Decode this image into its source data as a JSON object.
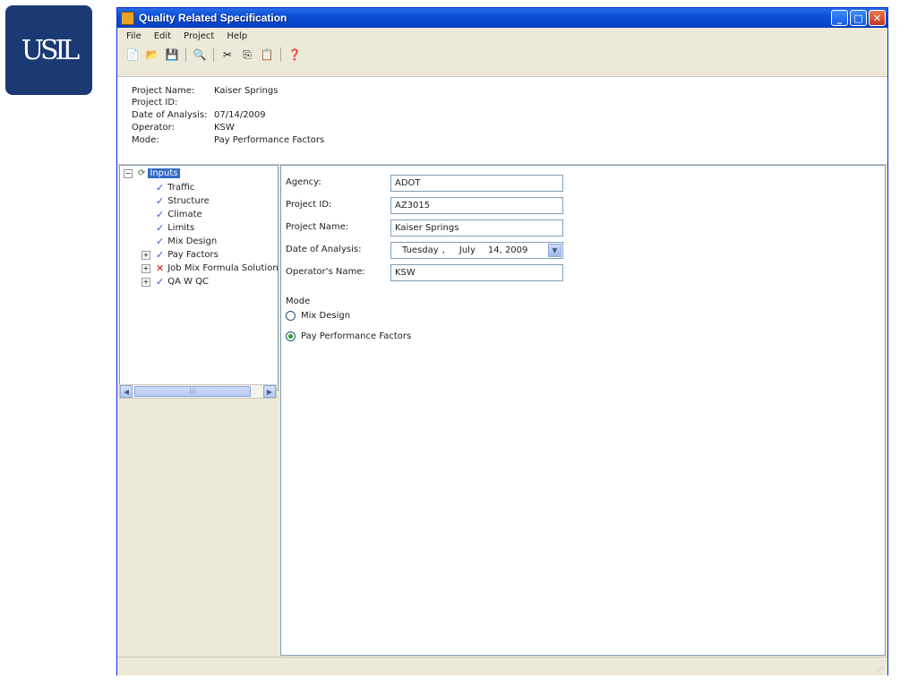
{
  "logo": {
    "text": "USIL"
  },
  "window": {
    "title": "Quality Related Specification",
    "controls": {
      "minimize": "_",
      "maximize": "□",
      "close": "✕"
    }
  },
  "menu": {
    "items": [
      "File",
      "Edit",
      "Project",
      "Help"
    ]
  },
  "toolbar": {
    "icons": [
      "new-icon",
      "open-icon",
      "save-icon",
      "print-preview-icon",
      "cut-icon",
      "copy-icon",
      "paste-icon",
      "help-icon"
    ]
  },
  "info": {
    "project_name_label": "Project Name:",
    "project_name": "Kaiser Springs",
    "project_id_label": "Project ID:",
    "project_id": "",
    "date_label": "Date of Analysis:",
    "date": "07/14/2009",
    "operator_label": "Operator:",
    "operator": "KSW",
    "mode_label": "Mode:",
    "mode": "Pay Performance Factors"
  },
  "tree": {
    "root": "Inputs",
    "items": [
      {
        "label": "Traffic",
        "status": "ok",
        "expandable": false
      },
      {
        "label": "Structure",
        "status": "ok",
        "expandable": false
      },
      {
        "label": "Climate",
        "status": "ok",
        "expandable": false
      },
      {
        "label": "Limits",
        "status": "ok",
        "expandable": false
      },
      {
        "label": "Mix Design",
        "status": "ok",
        "expandable": false
      },
      {
        "label": "Pay Factors",
        "status": "ok",
        "expandable": true
      },
      {
        "label": "Job Mix Formula Solution",
        "status": "error",
        "expandable": true
      },
      {
        "label": "QA W QC",
        "status": "ok",
        "expandable": true
      }
    ]
  },
  "form": {
    "agency_label": "Agency:",
    "agency_value": "ADOT",
    "project_id_label": "Project ID:",
    "project_id_value": "AZ3015",
    "project_name_label": "Project Name:",
    "project_name_value": "Kaiser Springs",
    "date_label": "Date of Analysis:",
    "date_weekday": "Tuesday",
    "date_month": "July",
    "date_day_year": "14, 2009",
    "operator_label": "Operator's Name:",
    "operator_value": "KSW",
    "mode_label": "Mode",
    "mode_options": [
      "Mix Design",
      "Pay Performance Factors"
    ],
    "mode_selected": "Pay Performance Factors"
  }
}
